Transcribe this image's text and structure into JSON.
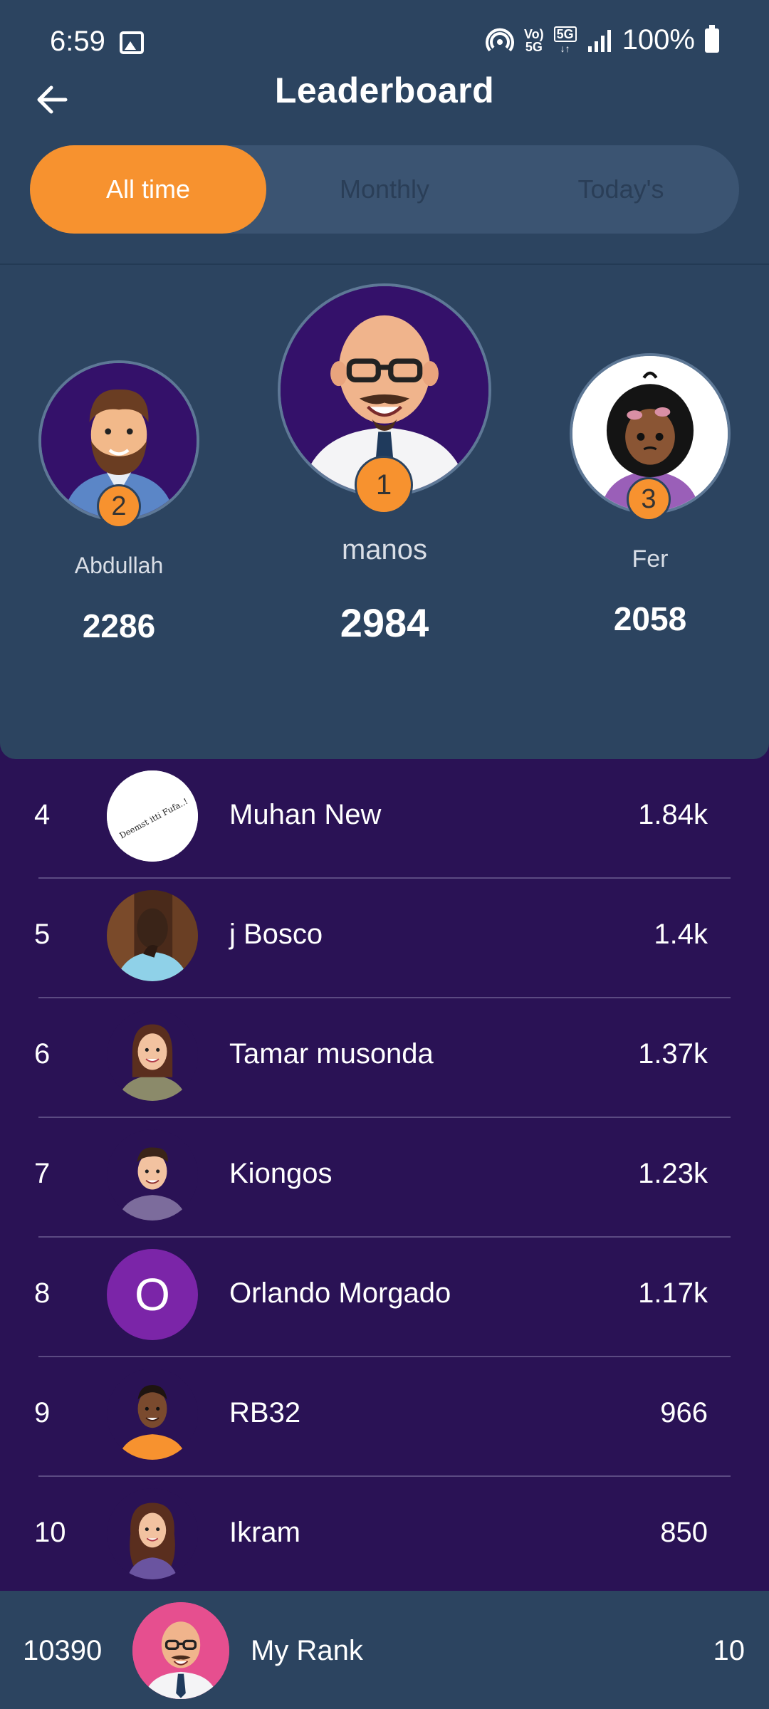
{
  "status_bar": {
    "time": "6:59",
    "network_label_top": "Vo)",
    "network_label_bottom": "5G",
    "network_5g": "5G",
    "battery_percent": "100%"
  },
  "header": {
    "title": "Leaderboard",
    "back_icon": "arrow-left-icon"
  },
  "tabs": [
    {
      "label": "All time",
      "active": true
    },
    {
      "label": "Monthly",
      "active": false
    },
    {
      "label": "Today's",
      "active": false
    }
  ],
  "podium": {
    "first": {
      "rank": "1",
      "name": "manos",
      "score": "2984"
    },
    "second": {
      "rank": "2",
      "name": "Abdullah",
      "score": "2286"
    },
    "third": {
      "rank": "3",
      "name": "Fer",
      "score": "2058"
    }
  },
  "list": [
    {
      "rank": "4",
      "name": "Muhan New",
      "score": "1.84k",
      "avatar": "text-logo",
      "avatar_text": "Deemst itti Fufa..!"
    },
    {
      "rank": "5",
      "name": "j Bosco",
      "score": "1.4k",
      "avatar": "photo"
    },
    {
      "rank": "6",
      "name": "Tamar musonda",
      "score": "1.37k",
      "avatar": "woman-cartoon"
    },
    {
      "rank": "7",
      "name": "Kiongos",
      "score": "1.23k",
      "avatar": "man-cartoon"
    },
    {
      "rank": "8",
      "name": "Orlando Morgado",
      "score": "1.17k",
      "avatar": "letter",
      "avatar_letter": "O"
    },
    {
      "rank": "9",
      "name": "RB32",
      "score": "966",
      "avatar": "man-dark-cartoon"
    },
    {
      "rank": "10",
      "name": "Ikram",
      "score": "850",
      "avatar": "woman-cartoon-2"
    }
  ],
  "my_rank": {
    "points": "10390",
    "label": "My Rank",
    "rank": "10"
  },
  "colors": {
    "header_bg": "#2c4460",
    "list_bg": "#2a1255",
    "accent": "#f7922f",
    "tab_track": "#3b5472"
  }
}
